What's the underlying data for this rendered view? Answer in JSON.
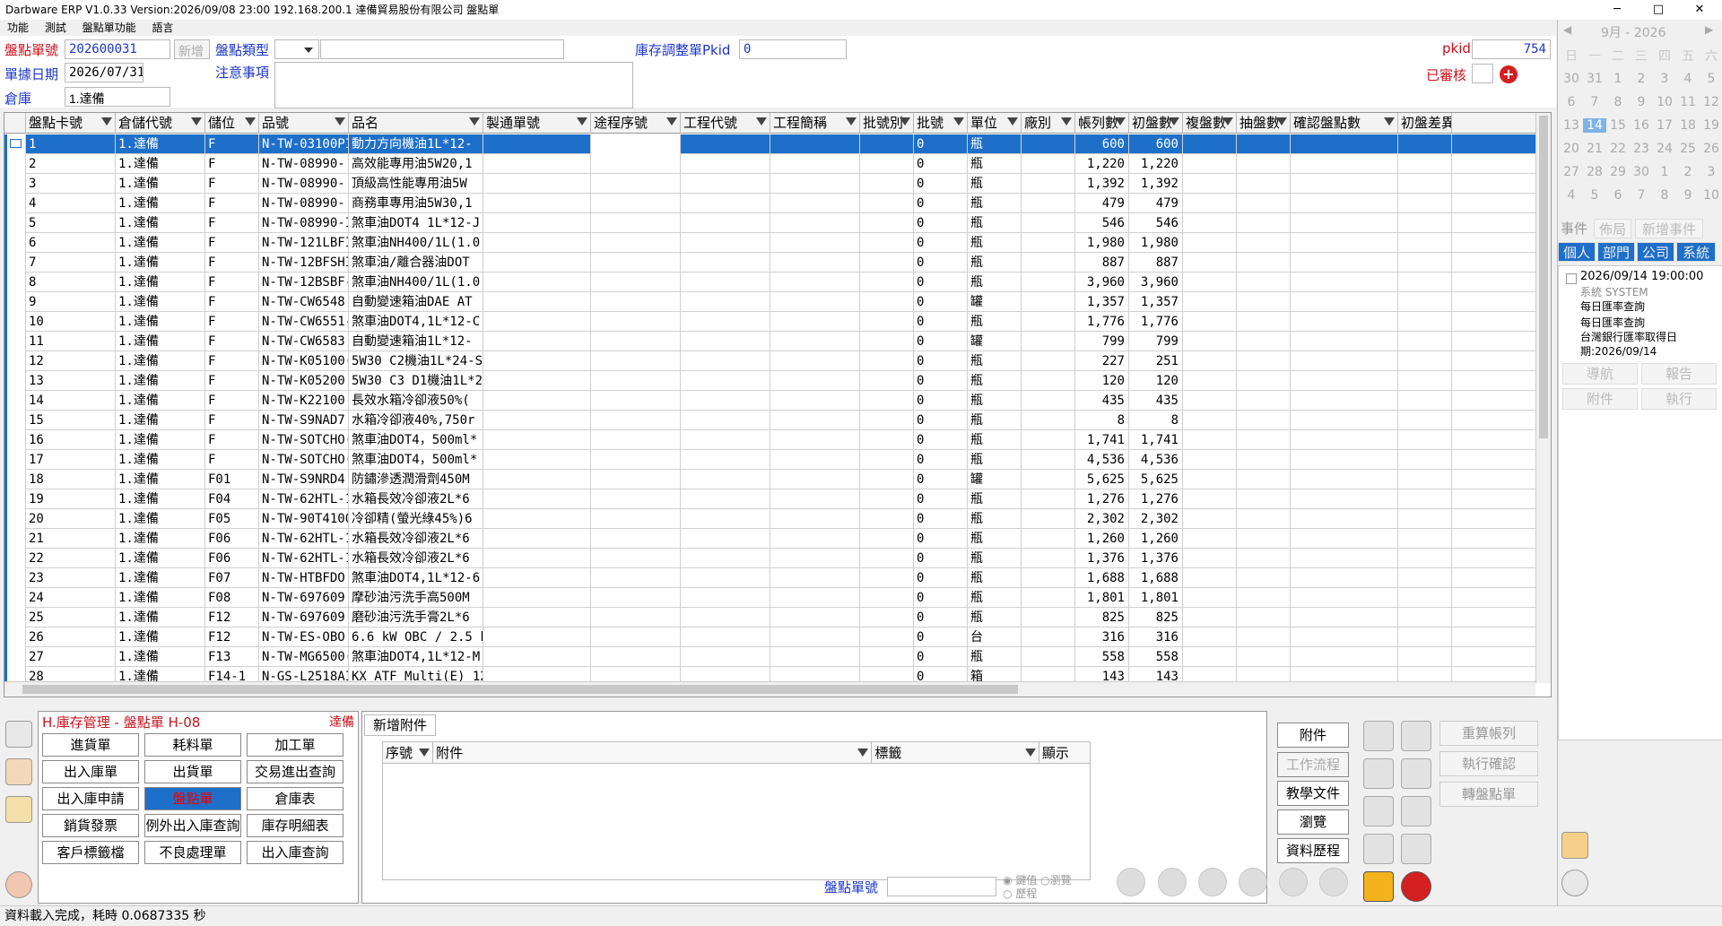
{
  "titlebar": {
    "title": "Darbware ERP V1.0.33 Version:2026/09/08 23:00   192.168.200.1 達備貿易股份有限公司 盤點單",
    "minimize": "─",
    "maximize": "□",
    "close": "✕"
  },
  "menu": [
    "功能",
    "測試",
    "盤點單功能",
    "語言"
  ],
  "form": {
    "doc_no_label": "盤點單號",
    "doc_no": "202600031",
    "new_btn": "新增",
    "type_label": "盤點類型",
    "type_value": "",
    "adj_label": "庫存調整單Pkid",
    "adj_value": "0",
    "pkid_label": "pkid",
    "pkid_value": "754",
    "date_label": "單據日期",
    "date_value": "2026/07/31",
    "note_label": "注意事項",
    "note_value": "",
    "warehouse_label": "倉庫",
    "warehouse_value": "1.達備",
    "audited_label": "已審核"
  },
  "grid": {
    "columns": [
      "盤點卡號",
      "倉儲代號",
      "儲位",
      "品號",
      "品名",
      "製通單號",
      "途程序號",
      "工程代號",
      "工程簡稱",
      "批號別",
      "批號",
      "單位",
      "廠別",
      "帳列數",
      "初盤數",
      "複盤數",
      "抽盤數",
      "確認盤點數",
      "初盤差異"
    ],
    "rows": [
      [
        "1",
        "1.達備",
        "F",
        "N-TW-03100PI",
        "動力方向機油1L*12-",
        "",
        "",
        "",
        "",
        "",
        "0",
        "瓶",
        "",
        "600",
        "600"
      ],
      [
        "2",
        "1.達備",
        "F",
        "N-TW-08990-.",
        "高效能專用油5W20,1",
        "",
        "",
        "",
        "",
        "",
        "0",
        "瓶",
        "",
        "1,220",
        "1,220"
      ],
      [
        "3",
        "1.達備",
        "F",
        "N-TW-08990-.",
        "頂級高性能專用油5W",
        "",
        "",
        "",
        "",
        "",
        "0",
        "瓶",
        "",
        "1,392",
        "1,392"
      ],
      [
        "4",
        "1.達備",
        "F",
        "N-TW-08990-.",
        "商務車專用油5W30,1",
        "",
        "",
        "",
        "",
        "",
        "0",
        "瓶",
        "",
        "479",
        "479"
      ],
      [
        "5",
        "1.達備",
        "F",
        "N-TW-08990-I",
        "煞車油DOT4 1L*12-J",
        "",
        "",
        "",
        "",
        "",
        "0",
        "瓶",
        "",
        "546",
        "546"
      ],
      [
        "6",
        "1.達備",
        "F",
        "N-TW-121LBFI",
        "煞車油NH400/1L(1.0",
        "",
        "",
        "",
        "",
        "",
        "0",
        "瓶",
        "",
        "1,980",
        "1,980"
      ],
      [
        "7",
        "1.達備",
        "F",
        "N-TW-12BFSHI",
        "煞車油/離合器油DOT",
        "",
        "",
        "",
        "",
        "",
        "0",
        "瓶",
        "",
        "887",
        "887"
      ],
      [
        "8",
        "1.達備",
        "F",
        "N-TW-12BSBF-",
        "煞車油NH400/1L(1.0",
        "",
        "",
        "",
        "",
        "",
        "0",
        "瓶",
        "",
        "3,960",
        "3,960"
      ],
      [
        "9",
        "1.達備",
        "F",
        "N-TW-CW6548:",
        "自動變速箱油DAE AT",
        "",
        "",
        "",
        "",
        "",
        "0",
        "罐",
        "",
        "1,357",
        "1,357"
      ],
      [
        "10",
        "1.達備",
        "F",
        "N-TW-CW6551-",
        "煞車油DOT4,1L*12-C",
        "",
        "",
        "",
        "",
        "",
        "0",
        "瓶",
        "",
        "1,776",
        "1,776"
      ],
      [
        "11",
        "1.達備",
        "F",
        "N-TW-CW6583:",
        "自動變速箱油1L*12-",
        "",
        "",
        "",
        "",
        "",
        "0",
        "罐",
        "",
        "799",
        "799"
      ],
      [
        "12",
        "1.達備",
        "F",
        "N-TW-K05100(",
        "5W30 C2機油1L*24-S",
        "",
        "",
        "",
        "",
        "",
        "0",
        "瓶",
        "",
        "227",
        "251"
      ],
      [
        "13",
        "1.達備",
        "F",
        "N-TW-K05200",
        "5W30 C3 D1機油1L*2",
        "",
        "",
        "",
        "",
        "",
        "0",
        "瓶",
        "",
        "120",
        "120"
      ],
      [
        "14",
        "1.達備",
        "F",
        "N-TW-K22100",
        "長效水箱冷卻液50%(",
        "",
        "",
        "",
        "",
        "",
        "0",
        "瓶",
        "",
        "435",
        "435"
      ],
      [
        "15",
        "1.達備",
        "F",
        "N-TW-S9NAD7.",
        "水箱冷卻液40%,750r",
        "",
        "",
        "",
        "",
        "",
        "0",
        "瓶",
        "",
        "8",
        "8"
      ],
      [
        "16",
        "1.達備",
        "F",
        "N-TW-SOTCHO(",
        "煞車油DOT4，500ml*",
        "",
        "",
        "",
        "",
        "",
        "0",
        "瓶",
        "",
        "1,741",
        "1,741"
      ],
      [
        "17",
        "1.達備",
        "F",
        "N-TW-SOTCHO(",
        "煞車油DOT4，500ml*",
        "",
        "",
        "",
        "",
        "",
        "0",
        "瓶",
        "",
        "4,536",
        "4,536"
      ],
      [
        "18",
        "1.達備",
        "F01",
        "N-TW-S9NRD4.",
        "防鏽滲透潤滑劑450M",
        "",
        "",
        "",
        "",
        "",
        "0",
        "罐",
        "",
        "5,625",
        "5,625"
      ],
      [
        "19",
        "1.達備",
        "F04",
        "N-TW-62HTL-1",
        "水箱長效冷卻液2L*6",
        "",
        "",
        "",
        "",
        "",
        "0",
        "瓶",
        "",
        "1,276",
        "1,276"
      ],
      [
        "20",
        "1.達備",
        "F05",
        "N-TW-90T4100",
        "冷卻精(螢光綠45%)6",
        "",
        "",
        "",
        "",
        "",
        "0",
        "瓶",
        "",
        "2,302",
        "2,302"
      ],
      [
        "21",
        "1.達備",
        "F06",
        "N-TW-62HTL-1",
        "水箱長效冷卻液2L*6",
        "",
        "",
        "",
        "",
        "",
        "0",
        "瓶",
        "",
        "1,260",
        "1,260"
      ],
      [
        "22",
        "1.達備",
        "F06",
        "N-TW-62HTL-1",
        "水箱長效冷卻液2L*6",
        "",
        "",
        "",
        "",
        "",
        "0",
        "瓶",
        "",
        "1,376",
        "1,376"
      ],
      [
        "23",
        "1.達備",
        "F07",
        "N-TW-HTBFDO'",
        "煞車油DOT4,1L*12-6",
        "",
        "",
        "",
        "",
        "",
        "0",
        "瓶",
        "",
        "1,688",
        "1,688"
      ],
      [
        "24",
        "1.達備",
        "F08",
        "N-TW-697609:",
        "摩砂油污洗手高500M",
        "",
        "",
        "",
        "",
        "",
        "0",
        "瓶",
        "",
        "1,801",
        "1,801"
      ],
      [
        "25",
        "1.達備",
        "F12",
        "N-TW-697609:",
        "磨砂油污洗手膏2L*6",
        "",
        "",
        "",
        "",
        "",
        "0",
        "瓶",
        "",
        "825",
        "825"
      ],
      [
        "26",
        "1.達備",
        "F12",
        "N-TW-ES-OBO",
        "6.6 kW OBC / 2.5 k",
        "",
        "",
        "",
        "",
        "",
        "0",
        "台",
        "",
        "316",
        "316"
      ],
      [
        "27",
        "1.達備",
        "F13",
        "N-TW-MG6500(",
        "煞車油DOT4,1L*12-M",
        "",
        "",
        "",
        "",
        "",
        "0",
        "瓶",
        "",
        "558",
        "558"
      ],
      [
        "28",
        "1.達備",
        "F14-1",
        "N-GS-L2518AI",
        "KX ATF Multi(E)_12",
        "",
        "",
        "",
        "",
        "",
        "0",
        "箱",
        "",
        "143",
        "143"
      ]
    ]
  },
  "module": {
    "title": "H.庫存管理 - 盤點單  H-08",
    "company": "達備",
    "buttons": [
      "進貨單",
      "耗料單",
      "加工單",
      "出入庫單",
      "出貨單",
      "交易進出查詢",
      "出入庫申請",
      "盤點單",
      "倉庫表",
      "銷貨發票",
      "例外出入庫查詢",
      "庫存明細表",
      "客戶標籤檔",
      "不良處理單",
      "出入庫查詢"
    ]
  },
  "attach": {
    "add_btn": "新增附件",
    "columns": [
      "序號",
      "附件",
      "標籤",
      "顯示"
    ],
    "side_buttons": [
      "附件",
      "工作流程",
      "教學文件",
      "瀏覽",
      "資料歷程"
    ],
    "search_label": "盤點單號",
    "radio_options": [
      "鍵值",
      "瀏覽",
      "歷程"
    ]
  },
  "actions": {
    "buttons": [
      "重算帳列",
      "執行確認",
      "轉盤點單"
    ]
  },
  "calendar": {
    "month_label": "9月 - 2026",
    "weekdays": [
      "日",
      "一",
      "二",
      "三",
      "四",
      "五",
      "六"
    ],
    "days": [
      "30",
      "31",
      "1",
      "2",
      "3",
      "4",
      "5",
      "6",
      "7",
      "8",
      "9",
      "10",
      "11",
      "12",
      "13",
      "14",
      "15",
      "16",
      "17",
      "18",
      "19",
      "20",
      "21",
      "22",
      "23",
      "24",
      "25",
      "26",
      "27",
      "28",
      "29",
      "30",
      "1",
      "2",
      "3",
      "4",
      "5",
      "6",
      "7",
      "8",
      "9",
      "10"
    ],
    "today": "14"
  },
  "events": {
    "tabs": [
      "事件",
      "佈局",
      "新增事件"
    ],
    "scopes": [
      "個人",
      "部門",
      "公司",
      "系統"
    ],
    "item": {
      "time": "2026/09/14 19:00:00",
      "source": "系統 SYSTEM",
      "title": "每日匯率查詢",
      "body": "每日匯率查詢",
      "detail1": "台灣銀行匯率取得日",
      "detail2": "期:2026/09/14"
    },
    "buttons": [
      "導航",
      "報告",
      "附件",
      "執行"
    ]
  },
  "status": "資料載入完成，耗時 0.0687335 秒",
  "colors": {
    "accent": "#1e6fc9",
    "label_blue": "#1c36c8",
    "label_red": "#c8141e"
  }
}
